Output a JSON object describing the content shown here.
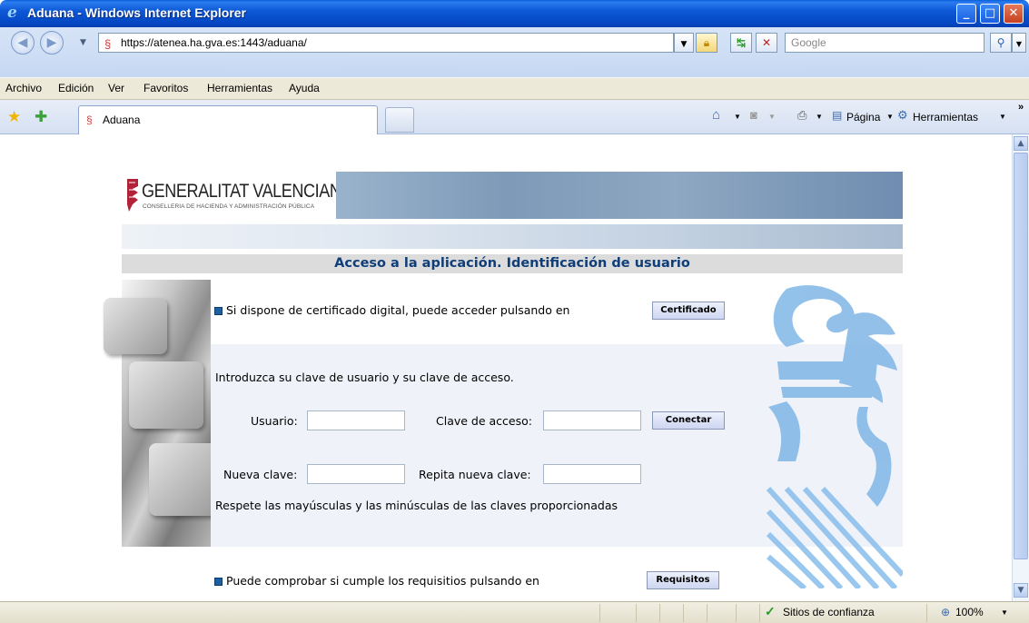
{
  "window": {
    "title": "Aduana - Windows Internet Explorer",
    "min": "_",
    "max": "□",
    "close": "✕"
  },
  "address": {
    "url": "https://atenea.ha.gva.es:1443/aduana/",
    "search_placeholder": "Google"
  },
  "menu": [
    "Archivo",
    "Edición",
    "Ver",
    "Favoritos",
    "Herramientas",
    "Ayuda"
  ],
  "tab": {
    "label": "Aduana"
  },
  "commands": {
    "page": "Página",
    "tools": "Herramientas"
  },
  "header": {
    "org_name": "GENERALITAT VALENCIANA",
    "org_sub": "CONSELLERIA DE HACIENDA Y ADMINISTRACIÓN PÚBLICA"
  },
  "page": {
    "title": "Acceso a la aplicación. Identificación de usuario",
    "cert_text": "Si dispone de certificado digital, puede acceder pulsando en",
    "cert_button": "Certificado",
    "intro": "Introduzca su clave de usuario y su clave de acceso.",
    "user_label": "Usuario:",
    "pass_label": "Clave de acceso:",
    "connect_button": "Conectar",
    "new_pass_label": "Nueva clave:",
    "repeat_pass_label": "Repita nueva clave:",
    "case_note": "Respete las mayúsculas y las minúsculas de las claves proporcionadas",
    "req_text": "Puede comprobar si cumple los requisitios pulsando en",
    "req_button": "Requisitos"
  },
  "status": {
    "zone": "Sitios de confianza",
    "zoom": "100%"
  },
  "colors": {
    "title_blue": "#103e78",
    "shield_blue": "#6aa8e0",
    "panel_bg": "#eff3f9"
  }
}
